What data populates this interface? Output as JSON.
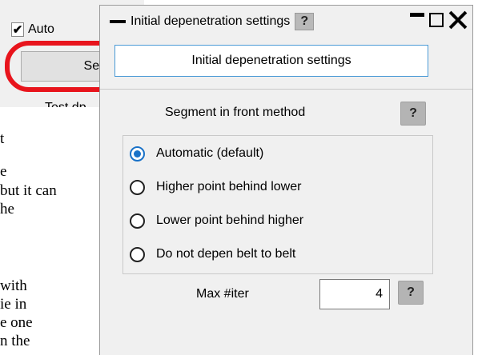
{
  "background": {
    "checkbox_mark": "✔",
    "checkbox_label": "Auto",
    "settings_button_label": "Sett",
    "cut_label": "Test dp",
    "doc_lines": [
      "t",
      "e",
      "but it can",
      "he",
      "with",
      "ie in",
      "e one",
      "n the"
    ]
  },
  "dialog": {
    "title": "Initial depenetration settings",
    "title_help": "?",
    "header": "Initial depenetration settings",
    "segment_label": "Segment in front method",
    "segment_help": "?",
    "options": [
      "Automatic (default)",
      "Higher point behind lower",
      "Lower point behind higher",
      "Do not depen belt to belt"
    ],
    "selected_option": 0,
    "max_iter_label": "Max #iter",
    "max_iter_value": "4",
    "max_iter_help": "?"
  },
  "colors": {
    "highlight": "#e8141c",
    "selected_radio": "#1a72c8",
    "header_border": "#4a9ad6"
  }
}
